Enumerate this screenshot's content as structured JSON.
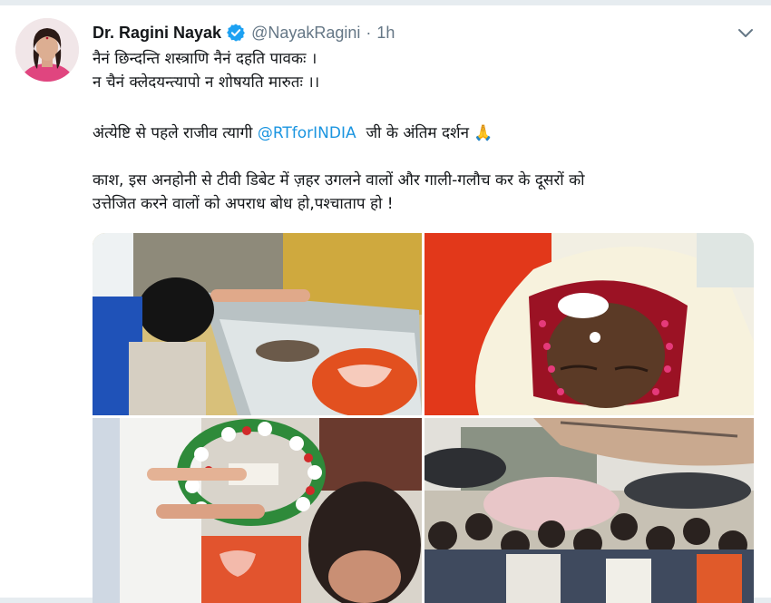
{
  "tweet": {
    "display_name": "Dr. Ragini Nayak",
    "handle": "@NayakRagini",
    "separator": "·",
    "time": "1h",
    "line1": "नैनं छिन्दन्ति शस्त्राणि नैनं दहति पावकः ।",
    "line2": "न चैनं क्लेदयन्त्यापो न शोषयति मारुतः ।।",
    "line3_before": "अंत्येष्टि से पहले राजीव त्यागी ",
    "mention": "@RTforINDIA",
    "line3_after": "  जी के अंतिम दर्शन ",
    "pray_emoji": "🙏",
    "line4": "काश, इस अनहोनी से टीवी डिबेट में ज़हर उगलने वालों और गाली-गलौच कर के दूसरों को",
    "line5": "उत्तेजित करने वालों को अपराध बोध हो,पश्चाताप हो !"
  },
  "icons": {
    "verified": "verified-badge-icon",
    "menu": "chevron-down-icon"
  },
  "colors": {
    "link": "#1b95e0",
    "verified": "#1da1f2",
    "muted": "#657786"
  },
  "photos": [
    {
      "alt": "photo-top-left"
    },
    {
      "alt": "photo-top-right"
    },
    {
      "alt": "photo-bottom-left"
    },
    {
      "alt": "photo-bottom-right"
    }
  ]
}
